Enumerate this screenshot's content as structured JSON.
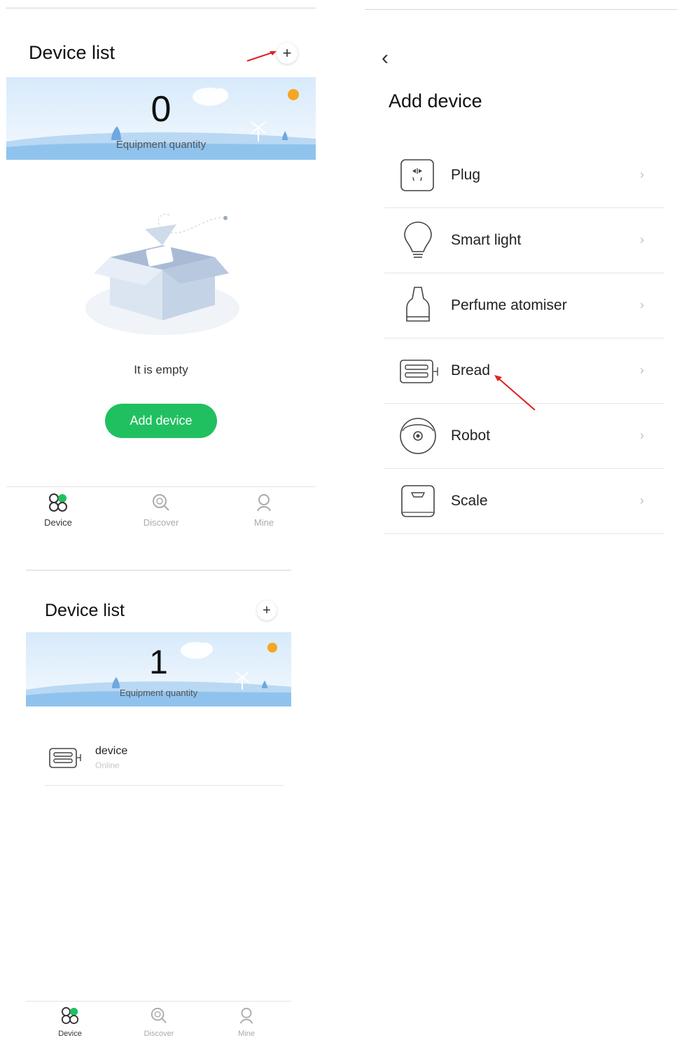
{
  "screen1": {
    "title": "Device list",
    "add_icon": "+",
    "count": "0",
    "count_label": "Equipment quantity",
    "empty_text": "It is empty",
    "add_button": "Add device"
  },
  "screen2": {
    "title": "Device list",
    "add_icon": "+",
    "count": "1",
    "count_label": "Equipment quantity",
    "device": {
      "name": "device",
      "status": "Online",
      "icon": "bread-maker-icon"
    }
  },
  "tabs": [
    {
      "label": "Device",
      "icon": "device-clover-icon",
      "active": true
    },
    {
      "label": "Discover",
      "icon": "discover-search-icon",
      "active": false
    },
    {
      "label": "Mine",
      "icon": "user-icon",
      "active": false
    }
  ],
  "add_device": {
    "back_icon": "‹",
    "title": "Add device",
    "items": [
      {
        "label": "Plug",
        "icon": "plug-icon"
      },
      {
        "label": "Smart light",
        "icon": "bulb-icon"
      },
      {
        "label": "Perfume atomiser",
        "icon": "atomiser-icon"
      },
      {
        "label": "Bread",
        "icon": "bread-maker-icon"
      },
      {
        "label": "Robot",
        "icon": "robot-vacuum-icon"
      },
      {
        "label": "Scale",
        "icon": "scale-icon"
      }
    ],
    "chevron": "›"
  },
  "colors": {
    "accent_green": "#20c060",
    "annotation_red": "#e02020",
    "sun": "#f5a623",
    "sky": "#dfeefb",
    "hill": "#9cc9ef"
  }
}
